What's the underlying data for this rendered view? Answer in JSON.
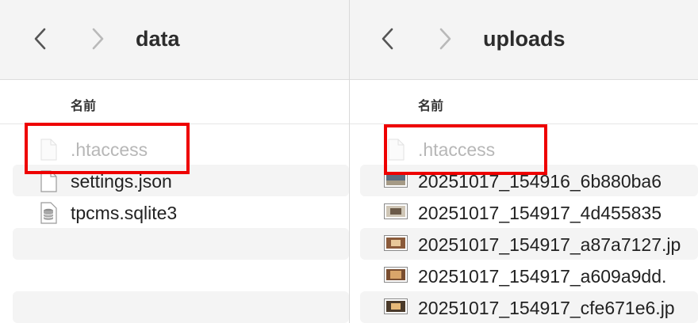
{
  "left_pane": {
    "title": "data",
    "column_header": "名前",
    "files": [
      {
        "name": ".htaccess",
        "icon": "document-icon",
        "hidden": true
      },
      {
        "name": "settings.json",
        "icon": "document-icon",
        "hidden": false
      },
      {
        "name": "tpcms.sqlite3",
        "icon": "database-icon",
        "hidden": false
      }
    ]
  },
  "right_pane": {
    "title": "uploads",
    "column_header": "名前",
    "files": [
      {
        "name": ".htaccess",
        "icon": "document-icon",
        "hidden": true
      },
      {
        "name": "20251017_154916_6b880ba6",
        "icon": "image-thumbnail-icon",
        "hidden": false
      },
      {
        "name": "20251017_154917_4d455835",
        "icon": "image-thumbnail-icon",
        "hidden": false
      },
      {
        "name": "20251017_154917_a87a7127.jp",
        "icon": "image-thumbnail-icon",
        "hidden": false
      },
      {
        "name": "20251017_154917_a609a9dd.",
        "icon": "image-thumbnail-icon",
        "hidden": false
      },
      {
        "name": "20251017_154917_cfe671e6.jp",
        "icon": "image-thumbnail-icon",
        "hidden": false
      }
    ]
  },
  "colors": {
    "highlight": "#ee0000",
    "stripe": "#f4f4f4",
    "toolbar": "#f4f4f4"
  }
}
